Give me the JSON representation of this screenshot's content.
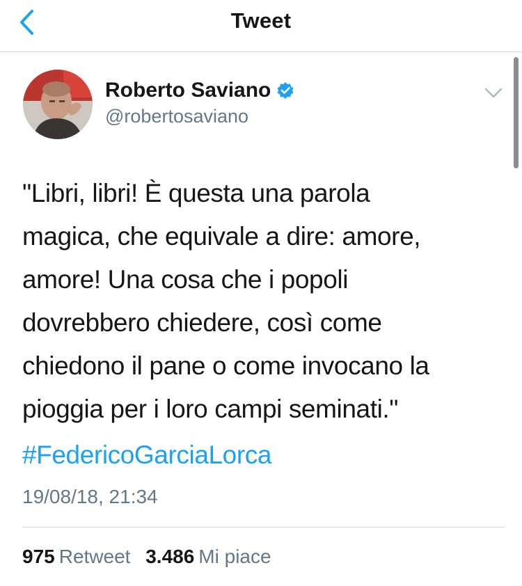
{
  "header": {
    "title": "Tweet",
    "back_icon": "chevron-left-icon"
  },
  "author": {
    "name": "Roberto Saviano",
    "handle": "@robertosaviano",
    "verified_icon": "verified-badge-icon"
  },
  "tweet": {
    "text": "\"Libri, libri! È questa una parola\nmagica, che equivale a dire: amore,\namore! Una cosa che i popoli\ndovrebbero chiedere, così come\nchiedono il pane o come invocano la\npioggia per i loro campi seminati.\"",
    "hashtag": "#FedericoGarciaLorca",
    "timestamp": "19/08/18, 21:34"
  },
  "stats": {
    "retweets_count": "975",
    "retweets_label": "Retweet",
    "likes_count": "3.486",
    "likes_label": "Mi piace"
  },
  "colors": {
    "accent": "#1da1f2",
    "secondary_text": "#657786",
    "primary_text": "#14171a"
  }
}
